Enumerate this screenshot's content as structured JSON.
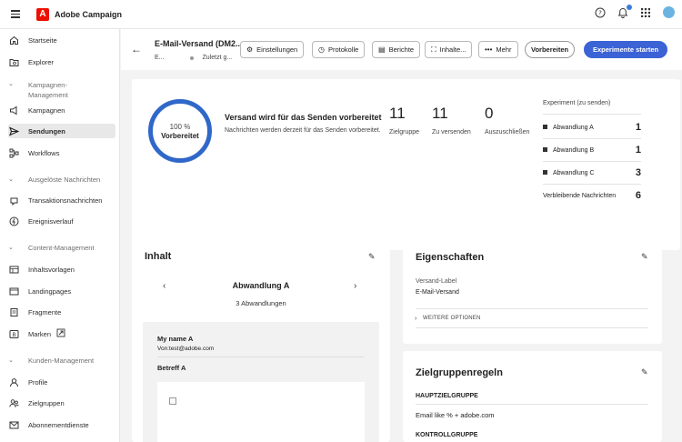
{
  "app": {
    "title": "Adobe Campaign",
    "logo_letter": "A"
  },
  "topbar_icons": [
    "help-icon",
    "bell-icon",
    "apps-grid-icon",
    "avatar"
  ],
  "sidebar": {
    "items": [
      {
        "label": "Startseite",
        "icon": "home-icon"
      },
      {
        "label": "Explorer",
        "icon": "explorer-icon"
      },
      {
        "section": "Kampagnen-Management"
      },
      {
        "label": "Kampagnen",
        "icon": "campaign-icon"
      },
      {
        "label": "Sendungen",
        "icon": "send-icon",
        "active": true
      },
      {
        "label": "Workflows",
        "icon": "workflow-icon"
      },
      {
        "section": "Ausgelöste Nachrichten"
      },
      {
        "label": "Transaktionsnachrichten",
        "icon": "transaction-icon"
      },
      {
        "label": "Ereignisverlauf",
        "icon": "event-history-icon"
      },
      {
        "section": "Content-Management"
      },
      {
        "label": "Inhaltsvorlagen",
        "icon": "template-icon"
      },
      {
        "label": "Landingpages",
        "icon": "landing-icon"
      },
      {
        "label": "Fragmente",
        "icon": "fragment-icon"
      },
      {
        "label": "Marken",
        "icon": "brand-icon"
      },
      {
        "section": "Kunden-Management"
      },
      {
        "label": "Profile",
        "icon": "profile-icon"
      },
      {
        "label": "Zielgruppen",
        "icon": "audience-icon"
      },
      {
        "label": "Abonnementdienste",
        "icon": "subscription-icon"
      }
    ]
  },
  "header": {
    "title": "E-Mail-Versand (DM2...",
    "sub_left": "E...",
    "sub_right": "Zuletzt g...",
    "buttons": {
      "settings": "Einstellungen",
      "logs": "Protokolle",
      "reports": "Berichte",
      "content": "Inhalte...",
      "more": "Mehr",
      "prepare": "Vorbereiten",
      "start": "Experimente starten"
    }
  },
  "status": {
    "progress_pct": "100 %",
    "progress_value": 100,
    "progress_label": "Vorbereitet",
    "title": "Versand wird für das Senden vorbereitet",
    "description": "Nachrichten werden derzeit für das Senden vorbereitet.",
    "metrics": [
      {
        "value": "11",
        "label": "Zielgruppe"
      },
      {
        "value": "11",
        "label": "Zu versenden"
      },
      {
        "value": "0",
        "label": "Auszuschließen"
      }
    ],
    "experiment": {
      "title": "Experiment (zu senden)",
      "rows": [
        {
          "label": "Abwandlung A",
          "value": "1"
        },
        {
          "label": "Abwandlung B",
          "value": "1"
        },
        {
          "label": "Abwandlung C",
          "value": "3"
        }
      ],
      "remaining_label": "Verbleibende Nachrichten",
      "remaining_value": "6"
    }
  },
  "content_card": {
    "title": "Inhalt",
    "variant_name": "Abwandlung A",
    "variant_count": "3 Abwandlungen",
    "from_name": "My name A",
    "from_addr": "Von:test@adobe.com",
    "subject": "Betreff A"
  },
  "properties_card": {
    "title": "Eigenschaften",
    "label": "Versand-Label",
    "value": "E-Mail-Versand",
    "more": "WEITERE OPTIONEN"
  },
  "audience_card": {
    "title": "Zielgruppenregeln",
    "main_heading": "HAUPTZIELGRUPPE",
    "main_rule": "Email like % + adobe.com",
    "control_heading": "KONTROLLGRUPPE"
  }
}
